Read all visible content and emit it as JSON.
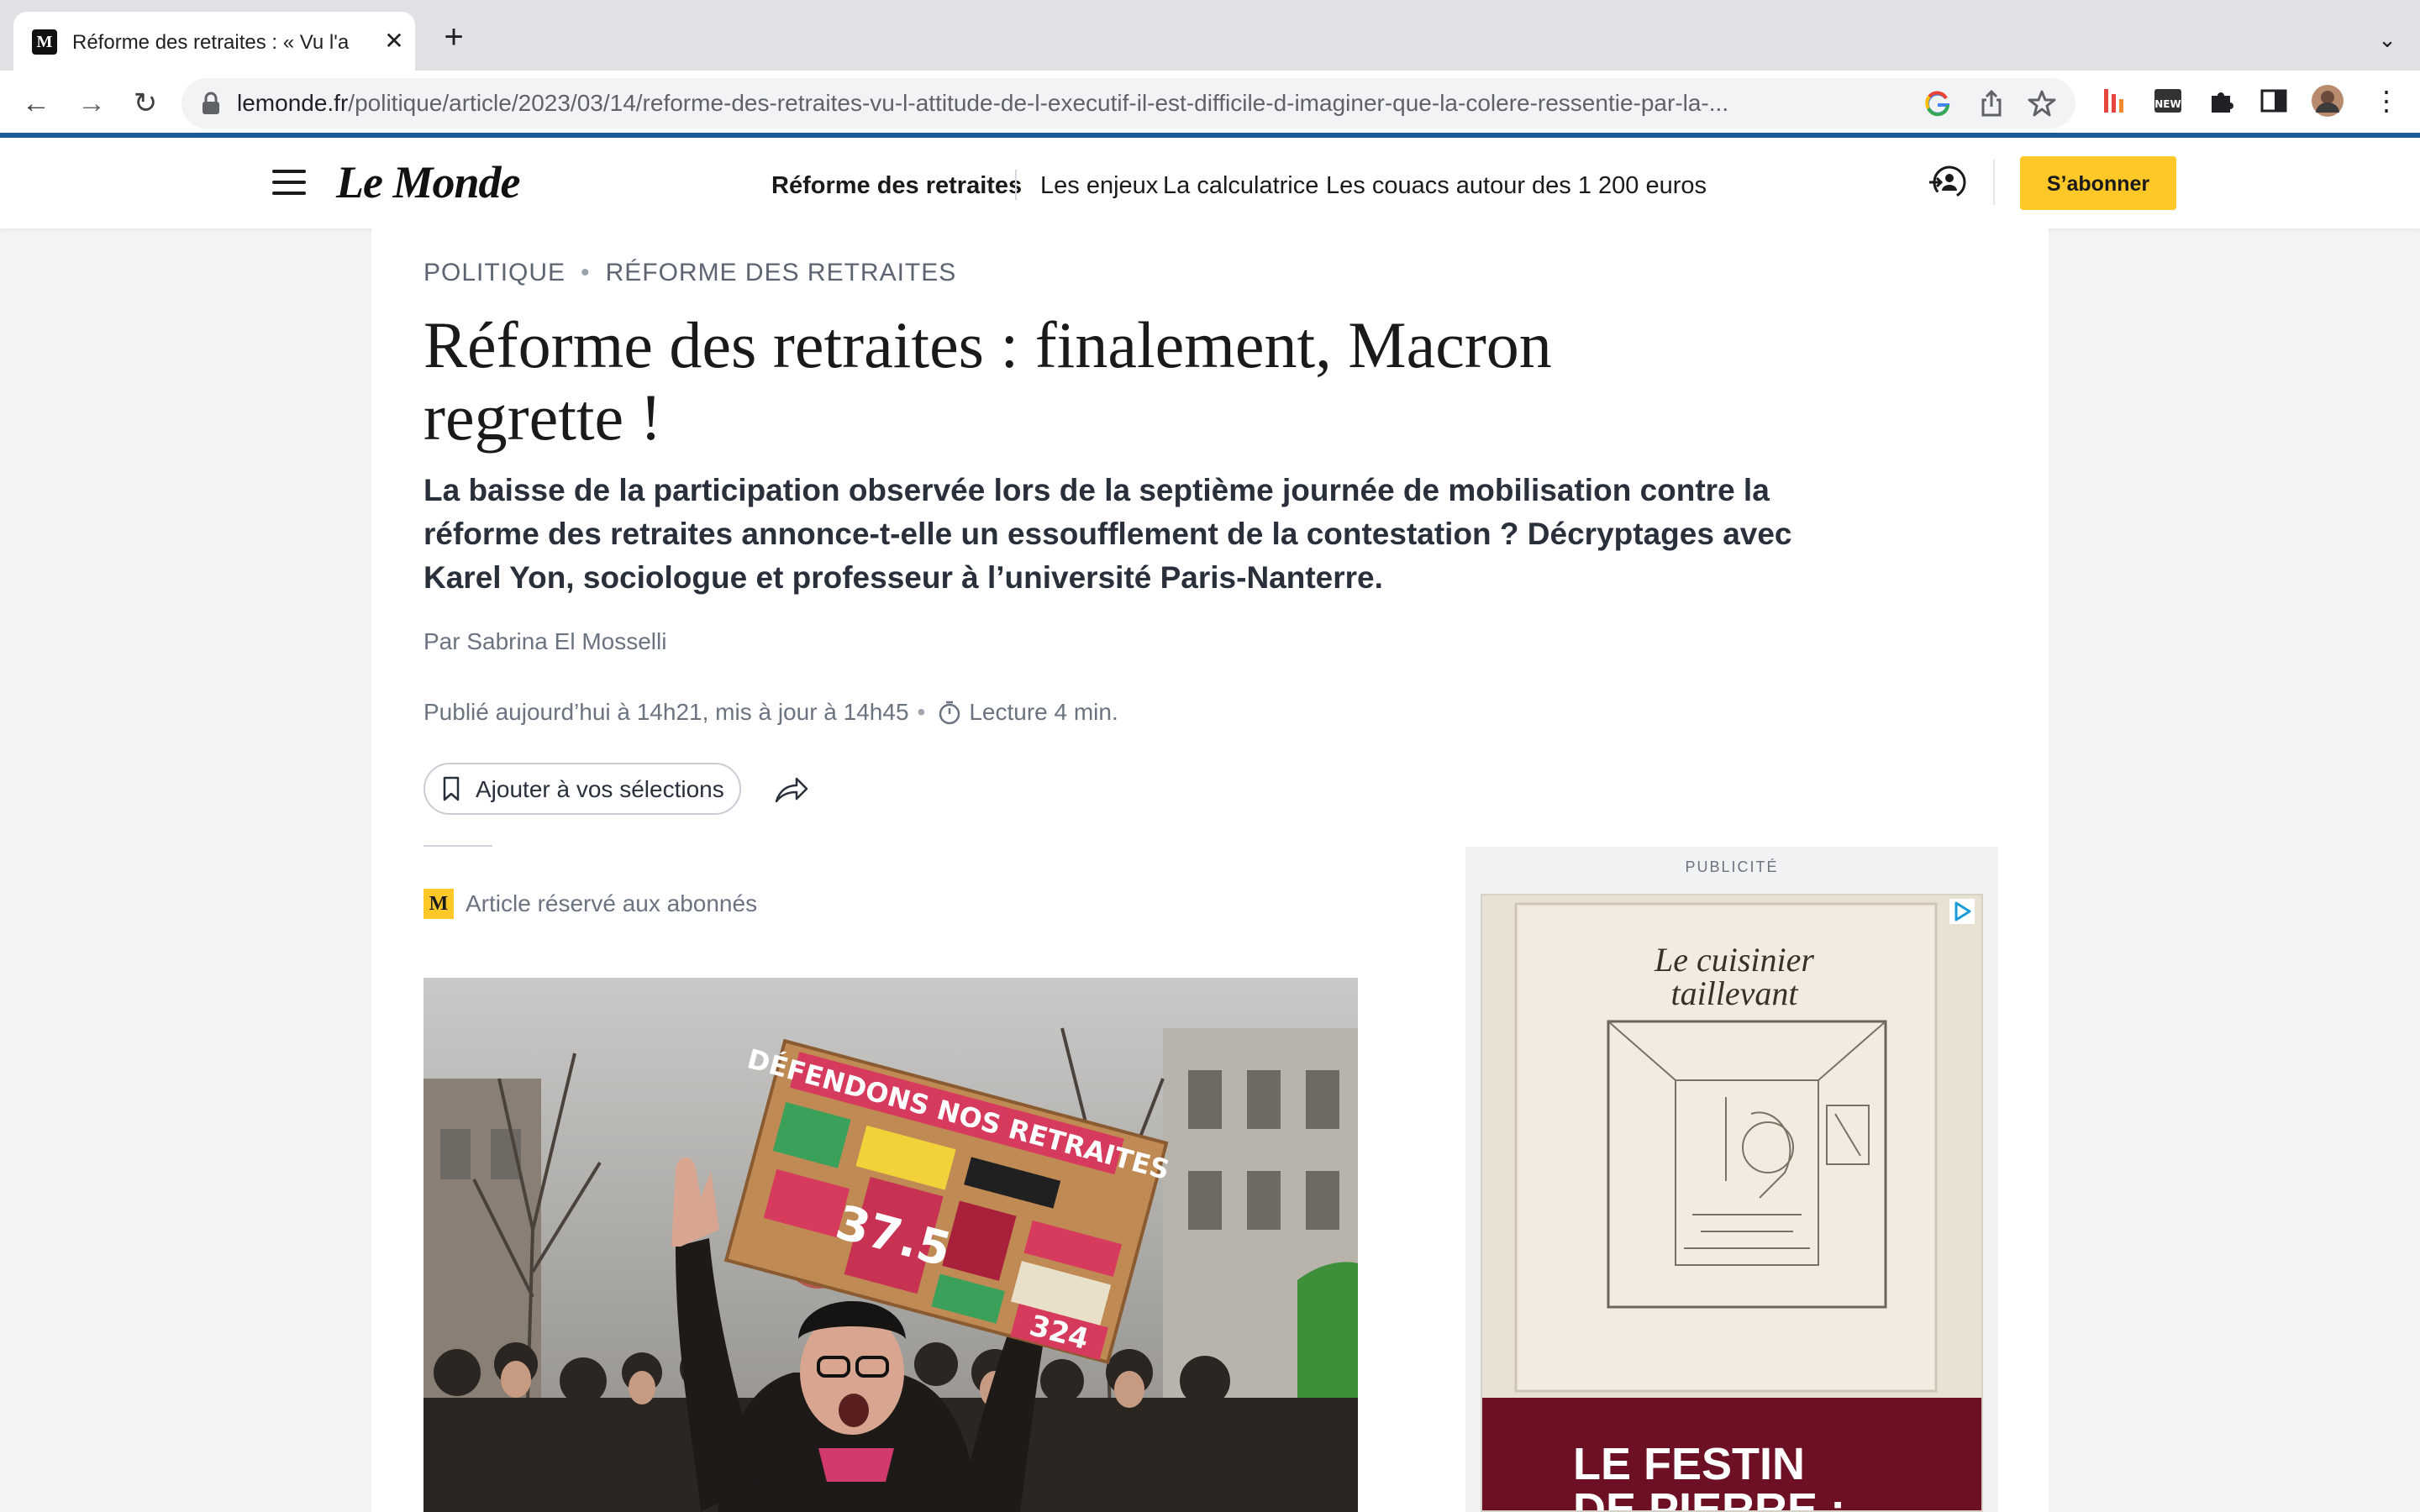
{
  "browser": {
    "tab_title": "Réforme des retraites : « Vu l'a",
    "tab_close": "✕",
    "new_tab": "+",
    "tabs_menu": "⌄",
    "url_host": "lemonde.fr",
    "url_path": "/politique/article/2023/03/14/reforme-des-retraites-vu-l-attitude-de-l-executif-il-est-difficile-d-imaginer-que-la-colere-ressentie-par-la-...",
    "back_icon": "←",
    "forward_icon": "→",
    "reload_icon": "↻"
  },
  "site": {
    "logo": "Le Monde",
    "nav": {
      "section": "Réforme des retraites",
      "items": [
        "Les enjeux",
        "La calculatrice",
        "Les couacs autour des 1 200 euros"
      ]
    },
    "subscribe_label": "S’abonner",
    "colors": {
      "accent_blue": "#1a5a96",
      "subscribe_yellow": "#ffc829"
    }
  },
  "article": {
    "kicker": {
      "rubric": "POLITIQUE",
      "sep": "•",
      "topic": "RÉFORME DES RETRAITES"
    },
    "title": "Réforme des retraites : finalement, Macron regrette !",
    "lead": "La baisse de la participation observée lors de la septième journée de mobilisation contre la réforme des retraites annonce-t-elle un essoufflement de la contestation ? Décryptages avec Karel Yon, sociologue et professeur à l’université Paris-Nanterre.",
    "byline": "Par Sabrina El Mosselli",
    "published": "Publié aujourd’hui à 14h21, mis à jour à 14h45",
    "meta_sep": "•",
    "reading_time": "Lecture 4 min.",
    "save_label": "Ajouter à vos sélections",
    "premium_badge": "M",
    "premium_label": "Article réservé aux abonnés",
    "photo": {
      "sign_title": "DÉFENDONS NOS RETRAITES",
      "sign_big": "37.5",
      "sign_corner": "324"
    }
  },
  "ad": {
    "label": "PUBLICITÉ",
    "book_caption_1": "Le cuisinier",
    "book_caption_2": "taillevant",
    "headline": "LE FESTIN\nDE PIERRE :"
  }
}
